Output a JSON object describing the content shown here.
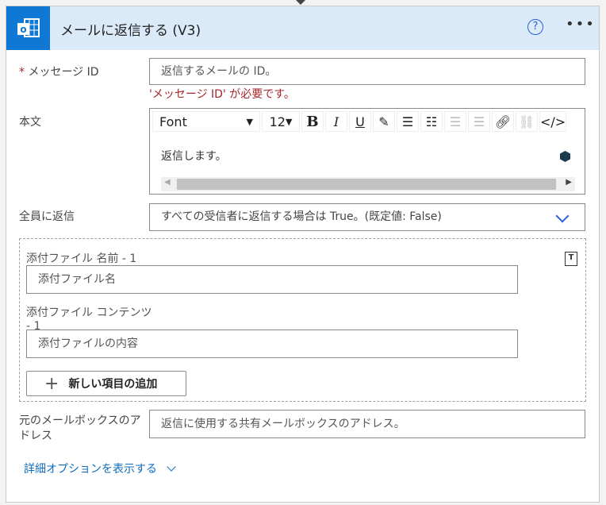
{
  "header": {
    "title": "メールに返信する (V3)",
    "help_icon": "question-circle-icon",
    "more_icon": "ellipsis-icon",
    "logo": "outlook-logo",
    "accent": "#0f78d4"
  },
  "fields": {
    "message_id": {
      "required": "*",
      "label": "メッセージ ID",
      "placeholder": "返信するメールの ID。",
      "error": "'メッセージ ID' が必要です。"
    },
    "body": {
      "label": "本文",
      "font": "Font",
      "size": "12",
      "content": "返信します。"
    },
    "reply_all": {
      "label": "全員に返信",
      "placeholder": "すべての受信者に返信する場合は True。(既定値: False)"
    },
    "attachments": {
      "name_label": "添付ファイル 名前 - 1",
      "name_placeholder": "添付ファイル名",
      "content_label": "添付ファイル コンテンツ - 1",
      "content_placeholder": "添付ファイルの内容",
      "add_label": "新しい項目の追加"
    },
    "mailbox": {
      "label": "元のメールボックスのアドレス",
      "placeholder": "返信に使用する共有メールボックスのアドレス。"
    }
  },
  "advanced": "詳細オプションを表示する"
}
